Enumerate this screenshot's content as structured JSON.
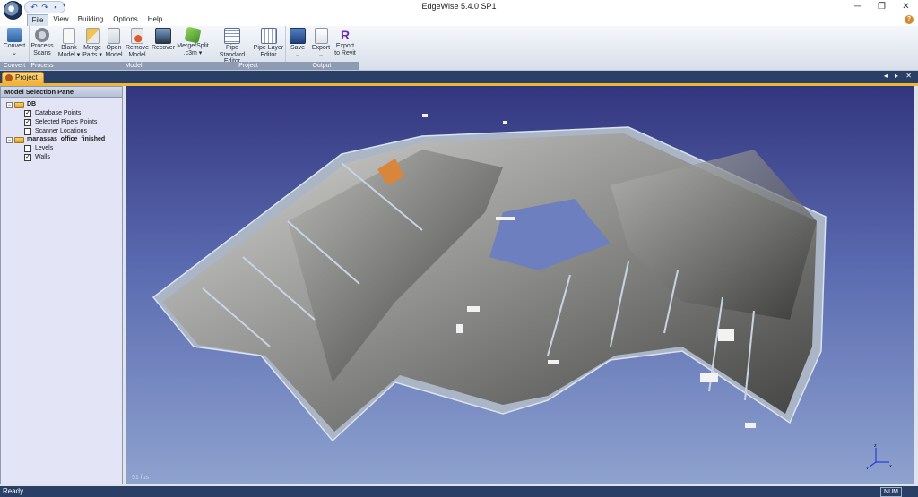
{
  "window": {
    "title": "EdgeWise 5.4.0 SP1",
    "minimize": "─",
    "restore": "❐",
    "close": "✕"
  },
  "qat": {
    "undo": "↶",
    "redo": "↷",
    "save": "▪",
    "dropdown": "▾"
  },
  "menu": {
    "tabs": [
      "File",
      "View",
      "Building",
      "Options",
      "Help"
    ],
    "active": "File",
    "help_icon": "?"
  },
  "ribbon": {
    "groups": [
      {
        "label": "Convert",
        "buttons": [
          {
            "label": "Convert\n⌄",
            "icon": "convert-icon"
          }
        ]
      },
      {
        "label": "Process",
        "buttons": [
          {
            "label": "Process\nScans",
            "icon": "process-scans-icon"
          }
        ]
      },
      {
        "label": "Model",
        "buttons": [
          {
            "label": "Blank\nModel ▾",
            "icon": "blank-model-icon"
          },
          {
            "label": "Merge\nParts ▾",
            "icon": "merge-parts-icon"
          },
          {
            "label": "Open\nModel",
            "icon": "open-model-icon"
          },
          {
            "label": "Remove\nModel",
            "icon": "remove-model-icon"
          },
          {
            "label": "Recover",
            "icon": "recover-icon"
          },
          {
            "label": "Merge/Split\n.c3m ▾",
            "icon": "merge-split-icon"
          }
        ]
      },
      {
        "label": "Project",
        "buttons": [
          {
            "label": "Pipe Standard\nEditor",
            "icon": "pipe-standard-editor-icon"
          },
          {
            "label": "Pipe Layer\nEditor",
            "icon": "pipe-layer-editor-icon"
          }
        ]
      },
      {
        "label": "Output",
        "buttons": [
          {
            "label": "Save\n⌄",
            "icon": "save-icon"
          },
          {
            "label": "Export\n⌄",
            "icon": "export-icon"
          },
          {
            "label": "Export\nto Revit",
            "icon": "revit-icon"
          }
        ]
      }
    ],
    "revit_glyph": "R"
  },
  "doc_tabs": {
    "active": "Project",
    "controls": "◂ ▸ ✕"
  },
  "pane": {
    "title": "Model Selection Pane",
    "tree": [
      {
        "label": "DB",
        "expand": "−",
        "bold": true,
        "children": [
          {
            "label": "Database Points",
            "checked": true
          },
          {
            "label": "Selected Pipe's Points",
            "checked": true
          },
          {
            "label": "Scanner Locations",
            "checked": false
          }
        ]
      },
      {
        "label": "manassas_office_finished",
        "expand": "−",
        "bold": true,
        "children": [
          {
            "label": "Levels",
            "checked": false
          },
          {
            "label": "Walls",
            "checked": true
          }
        ]
      }
    ],
    "check_glyph": "✓"
  },
  "viewport": {
    "fps": "51 fps",
    "axes": {
      "x": "x",
      "y": "y",
      "z": "z"
    }
  },
  "status": {
    "text": "Ready",
    "num": "NUM"
  },
  "colors": {
    "accent": "#f1b339",
    "dark_frame": "#2a3f66",
    "revit": "#6a2fb5",
    "wall": "#aab6c6"
  }
}
